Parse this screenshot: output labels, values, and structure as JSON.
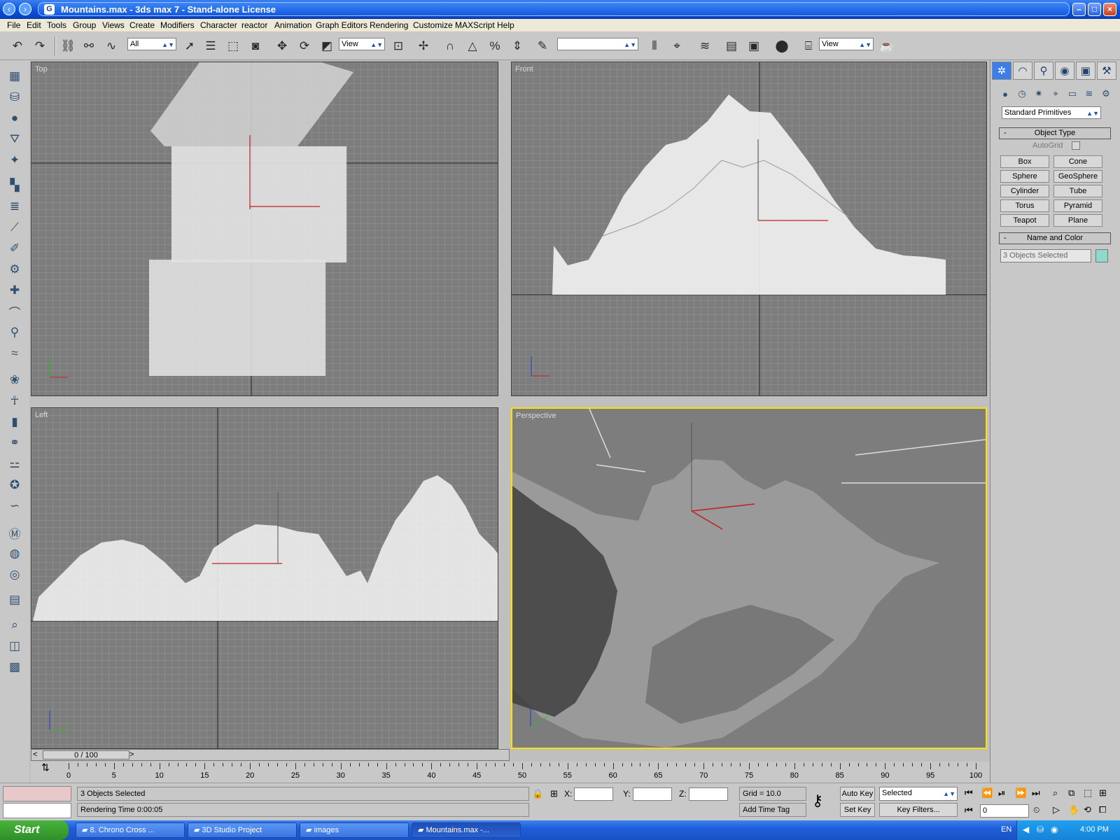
{
  "window": {
    "title": "Mountains.max - 3ds max 7  - Stand-alone License"
  },
  "menu": [
    "File",
    "Edit",
    "Tools",
    "Group",
    "Views",
    "Create",
    "Modifiers",
    "Character",
    "reactor",
    "Animation",
    "Graph Editors",
    "Rendering",
    "Customize",
    "MAXScript",
    "Help"
  ],
  "toolbar": {
    "selection_filter": "All",
    "ref_coord_1": "View",
    "ref_coord_2": "View",
    "named_selection": ""
  },
  "viewports": {
    "top": "Top",
    "front": "Front",
    "left": "Left",
    "perspective": "Perspective"
  },
  "command_panel": {
    "category": "Standard Primitives",
    "object_type_title": "Object Type",
    "autogrid_label": "AutoGrid",
    "buttons": [
      "Box",
      "Cone",
      "Sphere",
      "GeoSphere",
      "Cylinder",
      "Tube",
      "Torus",
      "Pyramid",
      "Teapot",
      "Plane"
    ],
    "name_color_title": "Name and Color",
    "name_field": "3 Objects Selected",
    "object_color": "#8fd8cc"
  },
  "time": {
    "slider_label": "0 / 100",
    "ticks": [
      "0",
      "5",
      "10",
      "15",
      "20",
      "25",
      "30",
      "35",
      "40",
      "45",
      "50",
      "55",
      "60",
      "65",
      "70",
      "75",
      "80",
      "85",
      "90",
      "95",
      "100"
    ]
  },
  "status": {
    "selection": "3 Objects Selected",
    "prompt": "Rendering Time  0:00:05",
    "x_label": "X:",
    "y_label": "Y:",
    "z_label": "Z:",
    "grid": "Grid = 10.0",
    "add_time_tag": "Add Time Tag",
    "auto_key": "Auto Key",
    "set_key": "Set Key",
    "key_mode": "Selected",
    "key_filters": "Key Filters...",
    "current_frame": "0"
  },
  "taskbar": {
    "start": "Start",
    "tasks": [
      "8. Chrono Cross ...",
      "3D Studio Project",
      "images",
      "Mountains.max -..."
    ],
    "lang": "EN",
    "clock": "4:00 PM"
  }
}
